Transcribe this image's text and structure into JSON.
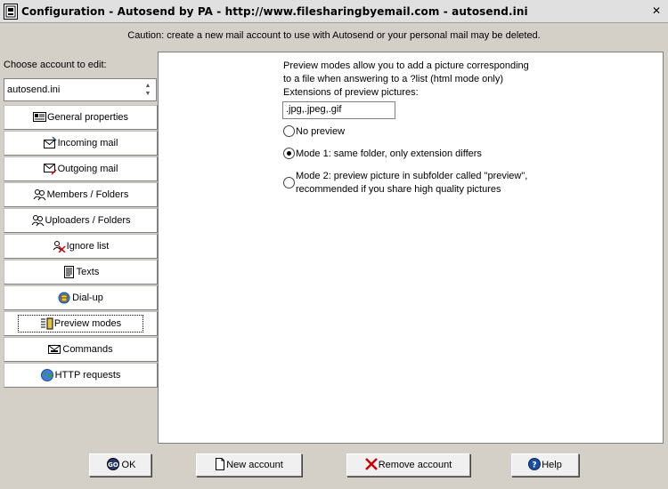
{
  "window": {
    "title": "Configuration - Autosend by PA - http://www.filesharingbyemail.com - autosend.ini",
    "close_glyph": "✕"
  },
  "caution": "Caution: create a new mail account to use with Autosend or your personal mail may be deleted.",
  "account": {
    "label": "Choose account to edit:",
    "selected": "autosend.ini"
  },
  "nav": {
    "items": [
      {
        "label": "General properties",
        "icon": "card-icon"
      },
      {
        "label": "Incoming mail",
        "icon": "incoming-mail-icon"
      },
      {
        "label": "Outgoing mail",
        "icon": "outgoing-mail-icon"
      },
      {
        "label": "Members / Folders",
        "icon": "members-icon"
      },
      {
        "label": "Uploaders / Folders",
        "icon": "uploaders-icon"
      },
      {
        "label": "Ignore list",
        "icon": "ignore-icon"
      },
      {
        "label": "Texts",
        "icon": "texts-icon"
      },
      {
        "label": "Dial-up",
        "icon": "dialup-icon"
      },
      {
        "label": "Preview modes",
        "icon": "preview-icon"
      },
      {
        "label": "Commands",
        "icon": "commands-icon"
      },
      {
        "label": "HTTP requests",
        "icon": "globe-icon"
      }
    ],
    "active_index": 8
  },
  "preview": {
    "description_line1": "Preview modes allow you to add a picture corresponding",
    "description_line2": "to a file when answering to a ?list (html mode only)",
    "extensions_label": "Extensions of preview pictures:",
    "extensions_value": ".jpg,.jpeg,.gif",
    "options": [
      {
        "label": "No preview",
        "checked": false
      },
      {
        "label": "Mode 1: same folder, only extension differs",
        "checked": true
      },
      {
        "label_line1": "Mode 2: preview picture in subfolder called \"preview\",",
        "label_line2": "recommended if you share high quality pictures",
        "checked": false
      }
    ]
  },
  "buttons": {
    "ok": "OK",
    "ok_icon_text": "GO",
    "new_account": "New account",
    "remove_account": "Remove account",
    "help": "Help"
  },
  "colors": {
    "window_bg": "#d4d0c8",
    "accent_red": "#cc0000",
    "accent_blue": "#1a4fa0"
  }
}
